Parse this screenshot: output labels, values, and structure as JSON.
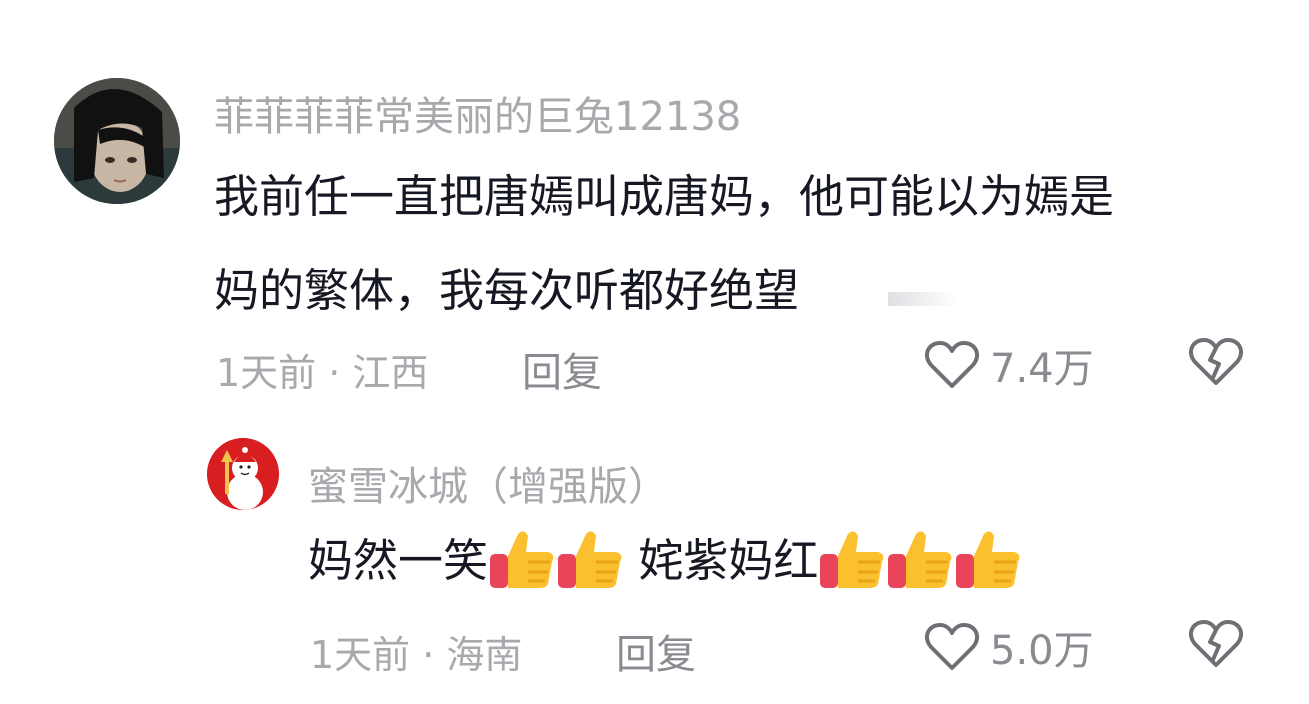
{
  "comments": [
    {
      "username": "菲菲菲菲常美丽的巨兔12138",
      "text_line1": "我前任一直把唐嫣叫成唐妈，他可能以为嫣是",
      "text_line2": "妈的繁体，我每次听都好绝望",
      "meta": "1天前 · 江西",
      "reply_label": "回复",
      "likes": "7.4万"
    },
    {
      "username": "蜜雪冰城（增强版）",
      "text_part1": "妈然一笑",
      "text_part2": " 姹紫妈红",
      "emoji_group1": [
        "thumbs-up",
        "thumbs-up"
      ],
      "emoji_group2": [
        "thumbs-up",
        "thumbs-up",
        "thumbs-up"
      ],
      "meta": "1天前 · 海南",
      "reply_label": "回复",
      "likes": "5.0万"
    }
  ],
  "colors": {
    "username": "#a8a8ad",
    "text": "#161823",
    "meta": "#a8a8ad",
    "reply": "#8a8a90",
    "icon": "#6f6f75",
    "brand_red": "#d91e22"
  }
}
